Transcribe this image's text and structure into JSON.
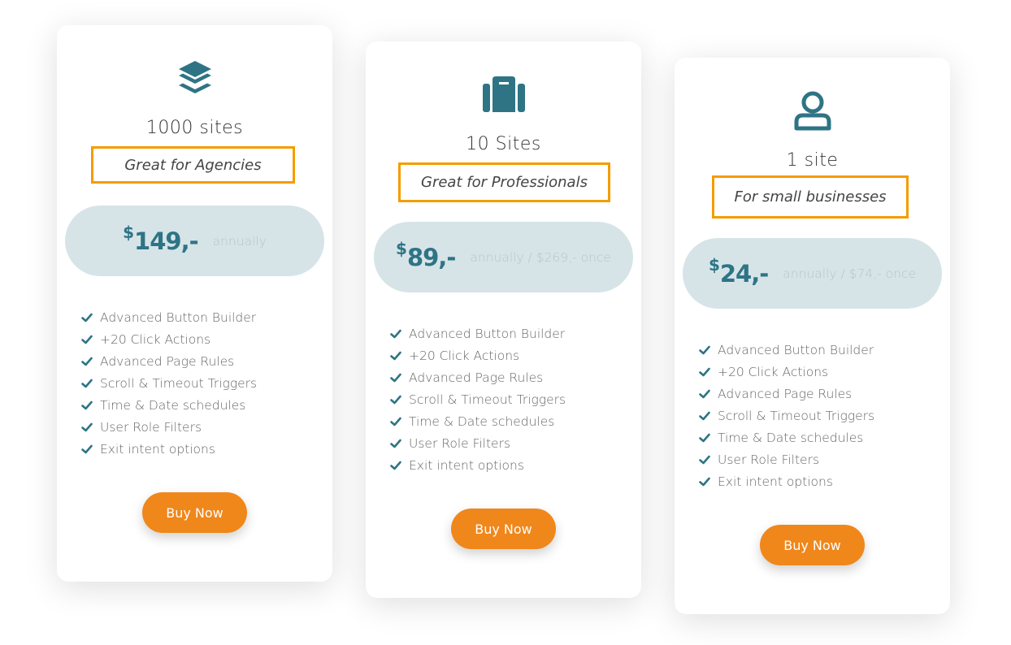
{
  "accent_color": "#2e7485",
  "highlight_color": "#f59c00",
  "button_color": "#f0871b",
  "plans": [
    {
      "icon": "layers-icon",
      "title": "1000 sites",
      "subtitle": "Great for Agencies",
      "currency": "$",
      "price": "149,-",
      "price_note": "annually",
      "features": [
        "Advanced Button Builder",
        "+20 Click Actions",
        "Advanced Page Rules",
        "Scroll & Timeout Triggers",
        "Time & Date schedules",
        "User Role Filters",
        "Exit intent options"
      ],
      "button_label": "Buy Now"
    },
    {
      "icon": "briefcase-icon",
      "title": "10 Sites",
      "subtitle": "Great for Professionals",
      "currency": "$",
      "price": "89,-",
      "price_note": "annually / $269,- once",
      "features": [
        "Advanced Button Builder",
        "+20 Click Actions",
        "Advanced Page Rules",
        "Scroll & Timeout Triggers",
        "Time & Date schedules",
        "User Role Filters",
        "Exit intent options"
      ],
      "button_label": "Buy Now"
    },
    {
      "icon": "user-icon",
      "title": "1 site",
      "subtitle": "For small businesses",
      "currency": "$",
      "price": "24,-",
      "price_note": "annually / $74,- once",
      "features": [
        "Advanced Button Builder",
        "+20 Click Actions",
        "Advanced Page Rules",
        "Scroll & Timeout Triggers",
        "Time & Date schedules",
        "User Role Filters",
        "Exit intent options"
      ],
      "button_label": "Buy Now"
    }
  ]
}
